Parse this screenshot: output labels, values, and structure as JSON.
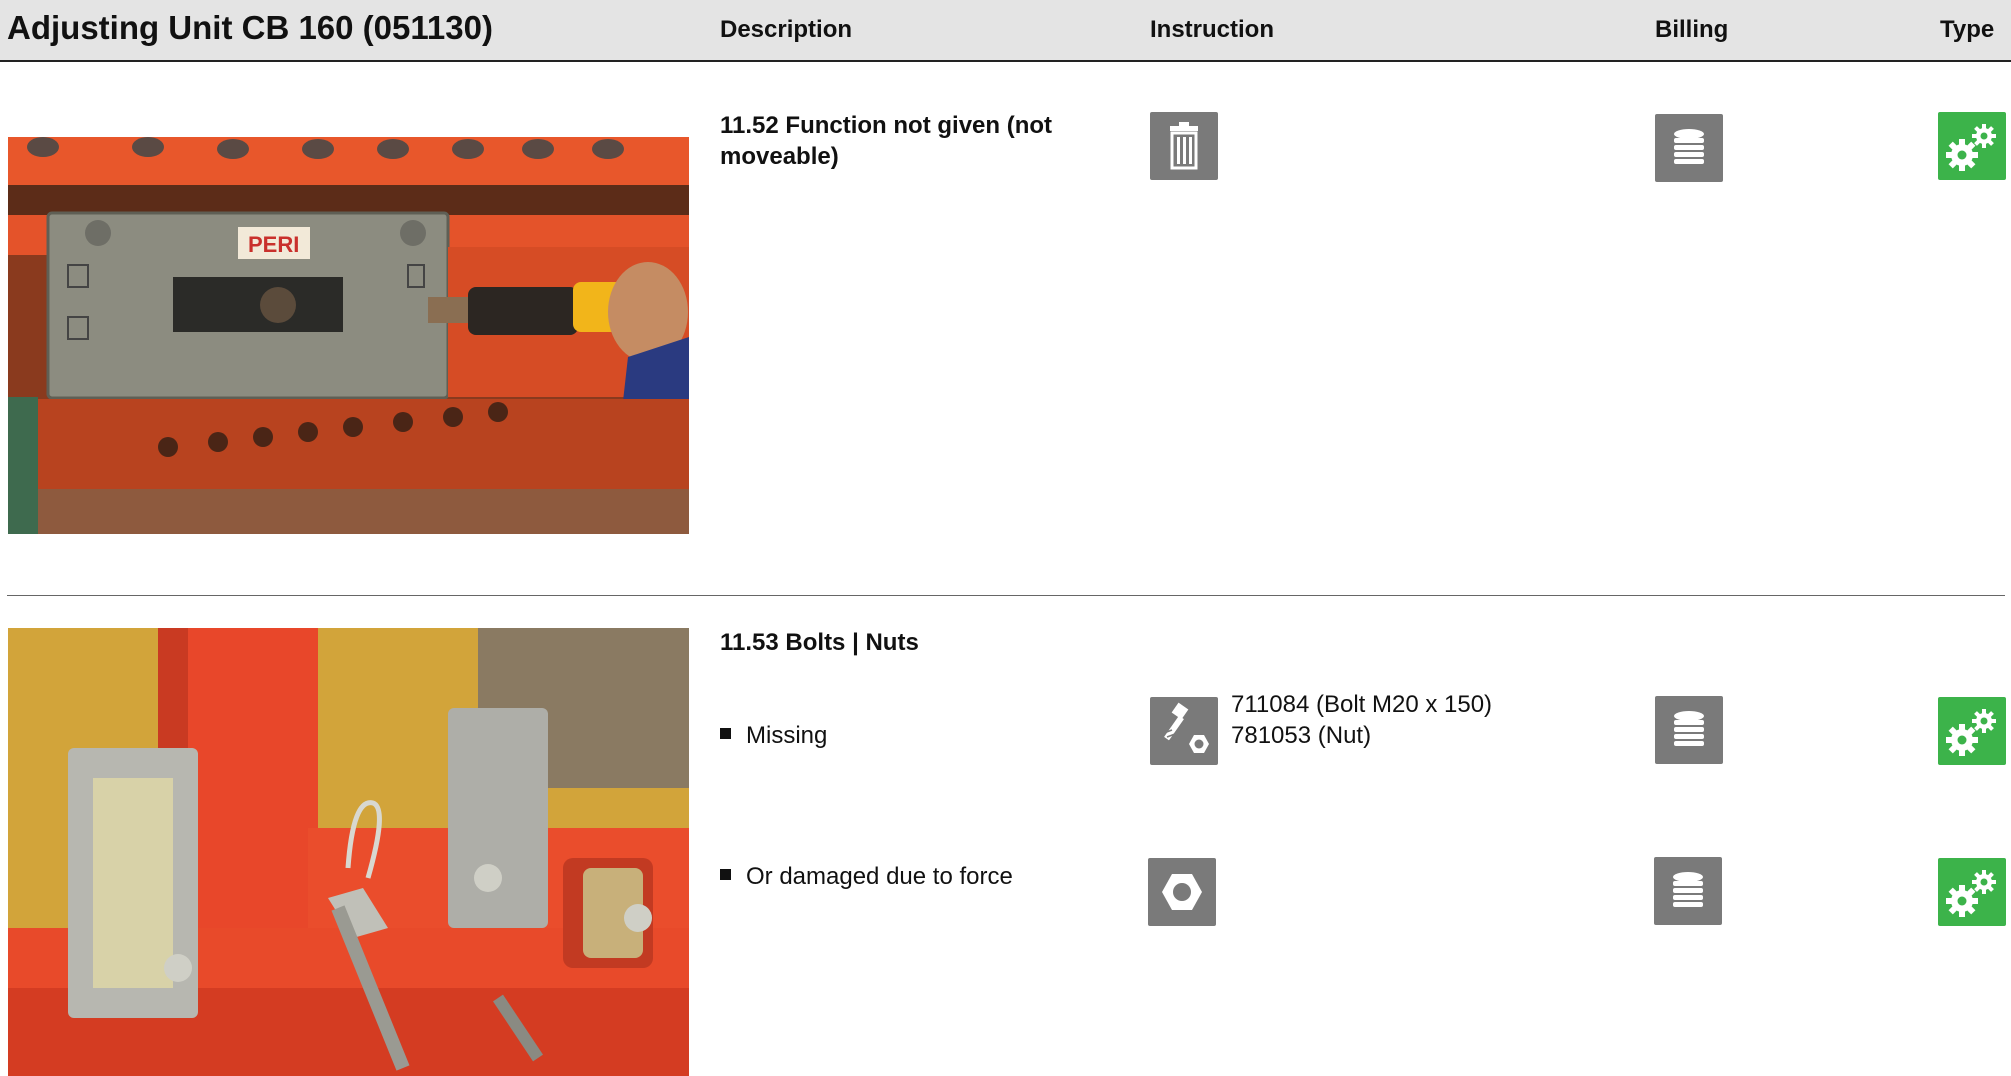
{
  "header": {
    "title": "Adjusting Unit CB 160 (051130)",
    "col_description": "Description",
    "col_instruction": "Instruction",
    "col_billing": "Billing",
    "col_type": "Type"
  },
  "sections": [
    {
      "heading_line1": "11.52 Function not given (not",
      "heading_line2": "moveable)",
      "instruction_icon": "trash-icon",
      "billing_icon": "coin-stack-icon",
      "type_icon": "gears-icon",
      "photo_label": "PERI"
    },
    {
      "heading": "11.53 Bolts | Nuts",
      "rows": [
        {
          "label": "Missing",
          "instruction_icon": "bolt-nut-icon",
          "parts": [
            "711084 (Bolt M20 x 150)",
            "781053 (Nut)"
          ],
          "billing_icon": "coin-stack-icon",
          "type_icon": "gears-icon"
        },
        {
          "label": "Or damaged due to force",
          "instruction_icon": "nut-icon",
          "billing_icon": "coin-stack-icon",
          "type_icon": "gears-icon"
        }
      ]
    }
  ],
  "colors": {
    "header_bg": "#e4e4e4",
    "icon_gray": "#7a7a7a",
    "icon_green": "#3cb34a",
    "photo_orange": "#e8502a"
  }
}
